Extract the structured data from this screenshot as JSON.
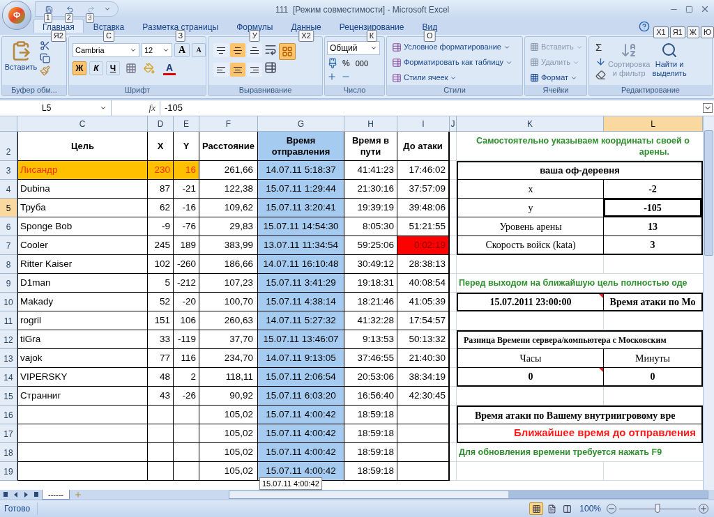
{
  "title_bar": {
    "title": "111  [Режим совместимости] - Microsoft Excel",
    "office_button": "Ф",
    "quick_access": [
      {
        "kind": "save",
        "key_tip": "1",
        "disabled": false
      },
      {
        "kind": "undo",
        "key_tip": "2",
        "disabled": false
      },
      {
        "kind": "redo",
        "key_tip": "3",
        "disabled": true
      }
    ]
  },
  "tabs": [
    {
      "label": "Главная",
      "key_tip": "Я2",
      "selected": true
    },
    {
      "label": "Вставка",
      "key_tip": "С",
      "selected": false
    },
    {
      "label": "Разметка страницы",
      "key_tip": "З",
      "selected": false
    },
    {
      "label": "Формулы",
      "key_tip": "У",
      "selected": false
    },
    {
      "label": "Данные",
      "key_tip": "Х2",
      "selected": false
    },
    {
      "label": "Рецензирование",
      "key_tip": "К",
      "selected": false
    },
    {
      "label": "Вид",
      "key_tip": "О",
      "selected": false
    }
  ],
  "right_key_tips": [
    "X1",
    "Я1",
    "Ж",
    "Ю"
  ],
  "ribbon": {
    "clipboard": {
      "label": "Буфер обм...",
      "paste": "Вставить"
    },
    "font": {
      "label": "Шрифт",
      "family": "Cambria",
      "size": "12",
      "grow": "A",
      "shrink": "A",
      "styles": [
        {
          "kind": "bold",
          "glyph": "Ж",
          "on": true
        },
        {
          "kind": "italic",
          "glyph": "К",
          "on": false
        },
        {
          "kind": "underline",
          "glyph": "Ч",
          "on": false
        }
      ],
      "font_color": "A"
    },
    "alignment": {
      "label": "Выравнивание",
      "vertical": [
        {
          "kind": "top",
          "selected": false
        },
        {
          "kind": "middle",
          "selected": true
        },
        {
          "kind": "bottom",
          "selected": false
        }
      ],
      "horizontal": [
        {
          "kind": "left",
          "selected": false
        },
        {
          "kind": "center",
          "selected": true
        },
        {
          "kind": "right",
          "selected": false
        }
      ],
      "wrap_on": true
    },
    "number": {
      "label": "Число",
      "format": "Общий",
      "percent": "%",
      "thousands": "000"
    },
    "styles": {
      "label": "Стили",
      "items": [
        "Условное форматирование",
        "Форматировать как таблицу",
        "Стили ячеек"
      ]
    },
    "cells": {
      "label": "Ячейки",
      "items": [
        {
          "label": "Вставить",
          "disabled": true
        },
        {
          "label": "Удалить",
          "disabled": true
        },
        {
          "label": "Формат",
          "disabled": false
        }
      ]
    },
    "editing": {
      "label": "Редактирование",
      "sum": "Σ",
      "sort": {
        "lines": [
          "Сортировка",
          "и фильтр"
        ],
        "disabled": true
      },
      "find": {
        "lines": [
          "Найти и",
          "выделить"
        ]
      }
    }
  },
  "formula_bar": {
    "name_box": "L5",
    "fx": "fx",
    "value": "-105"
  },
  "columns": [
    {
      "label": "C",
      "selected": false
    },
    {
      "label": "D",
      "selected": false
    },
    {
      "label": "E",
      "selected": false
    },
    {
      "label": "F",
      "selected": false
    },
    {
      "label": "G",
      "selected": false
    },
    {
      "label": "H",
      "selected": false
    },
    {
      "label": "I",
      "selected": false
    },
    {
      "label": "J",
      "selected": false
    },
    {
      "label": "K",
      "selected": false
    },
    {
      "label": "L",
      "selected": true
    }
  ],
  "header_row": {
    "num": "2",
    "selected": false,
    "cells": [
      "Цель",
      "X",
      "Y",
      "Расстояние",
      "Время отправления",
      "Время в пути",
      "До атаки"
    ],
    "panel": {
      "kind": "note",
      "lines": [
        "Самостоятельно указываем координаты своей о",
        "арены."
      ]
    }
  },
  "rows": [
    {
      "num": "3",
      "selected": false,
      "highlight": true,
      "overdue": false,
      "cells": [
        "Лисандр",
        "230",
        "16",
        "261,66",
        "14.07.11 5:18:37",
        "41:41:23",
        "17:46:02"
      ],
      "panel": {
        "kind": "title",
        "text": "ваша оф-деревня"
      }
    },
    {
      "num": "4",
      "selected": false,
      "highlight": false,
      "overdue": false,
      "cells": [
        "Dubina",
        "87",
        "-21",
        "122,38",
        "15.07.11 1:29:44",
        "21:30:16",
        "37:57:09"
      ],
      "panel": {
        "kind": "pair",
        "left": {
          "text": "x",
          "bold": false,
          "comment": false
        },
        "right": {
          "text": "-2",
          "bold": true,
          "selected": false
        }
      }
    },
    {
      "num": "5",
      "selected": true,
      "highlight": false,
      "overdue": false,
      "cells": [
        "Труба",
        "62",
        "-16",
        "109,62",
        "15.07.11 3:20:41",
        "19:39:19",
        "39:48:06"
      ],
      "panel": {
        "kind": "pair",
        "left": {
          "text": "y",
          "bold": false,
          "comment": false
        },
        "right": {
          "text": "-105",
          "bold": true,
          "selected": true
        }
      }
    },
    {
      "num": "6",
      "selected": false,
      "highlight": false,
      "overdue": false,
      "cells": [
        "Sponge Bob",
        "-9",
        "-76",
        "29,83",
        "15.07.11 14:54:30",
        "8:05:30",
        "51:21:55"
      ],
      "panel": {
        "kind": "pair",
        "left": {
          "text": "Уровень арены",
          "bold": false,
          "comment": false
        },
        "right": {
          "text": "13",
          "bold": true,
          "selected": false
        }
      }
    },
    {
      "num": "7",
      "selected": false,
      "highlight": false,
      "overdue": true,
      "cells": [
        "Cooler",
        "245",
        "189",
        "383,99",
        "13.07.11 11:34:54",
        "59:25:06",
        "0:02:19"
      ],
      "panel": {
        "kind": "pair",
        "left": {
          "text": "Скорость войск (kata)",
          "bold": false,
          "comment": false
        },
        "right": {
          "text": "3",
          "bold": true,
          "selected": false
        }
      }
    },
    {
      "num": "8",
      "selected": false,
      "highlight": false,
      "overdue": false,
      "cells": [
        "Ritter Kaiser",
        "102",
        "-260",
        "186,66",
        "14.07.11 16:10:48",
        "30:49:12",
        "28:38:13"
      ],
      "panel": {
        "kind": "empty"
      }
    },
    {
      "num": "9",
      "selected": false,
      "highlight": false,
      "overdue": false,
      "cells": [
        "D1man",
        "5",
        "-212",
        "107,23",
        "15.07.11 3:41:29",
        "19:18:31",
        "40:08:54"
      ],
      "panel": {
        "kind": "note",
        "lines": [
          "Перед выходом на ближайшую цель полностью оде"
        ]
      }
    },
    {
      "num": "10",
      "selected": false,
      "highlight": false,
      "overdue": false,
      "cells": [
        "Makady",
        "52",
        "-20",
        "100,70",
        "15.07.11 4:38:14",
        "18:21:46",
        "41:05:39"
      ],
      "panel": {
        "kind": "pair",
        "left": {
          "text": "15.07.2011 23:00:00",
          "bold": true,
          "comment": true
        },
        "right": {
          "text": "Время атаки по Мо",
          "bold": true,
          "selected": false
        }
      }
    },
    {
      "num": "11",
      "selected": false,
      "highlight": false,
      "overdue": false,
      "cells": [
        "rogril",
        "151",
        "106",
        "260,63",
        "14.07.11 5:27:32",
        "41:32:28",
        "17:54:57"
      ],
      "panel": {
        "kind": "empty"
      }
    },
    {
      "num": "12",
      "selected": false,
      "highlight": false,
      "overdue": false,
      "cells": [
        "tiGra",
        "33",
        "-119",
        "37,70",
        "15.07.11 13:46:07",
        "9:13:53",
        "50:13:32"
      ],
      "panel": {
        "kind": "caption",
        "text": "Разница Времени сервера/компьютера с Московским"
      }
    },
    {
      "num": "13",
      "selected": false,
      "highlight": false,
      "overdue": false,
      "cells": [
        "vajok",
        "77",
        "116",
        "234,70",
        "14.07.11 9:13:05",
        "37:46:55",
        "21:40:30"
      ],
      "panel": {
        "kind": "pair",
        "left": {
          "text": "Часы",
          "bold": false,
          "comment": false
        },
        "right": {
          "text": "Минуты",
          "bold": false,
          "selected": false
        }
      }
    },
    {
      "num": "14",
      "selected": false,
      "highlight": false,
      "overdue": false,
      "cells": [
        "VIPERSKY",
        "48",
        "2",
        "118,11",
        "15.07.11 2:06:54",
        "20:53:06",
        "38:34:19"
      ],
      "panel": {
        "kind": "pair",
        "left": {
          "text": "0",
          "bold": true,
          "comment": true
        },
        "right": {
          "text": "0",
          "bold": true,
          "selected": false
        }
      }
    },
    {
      "num": "15",
      "selected": false,
      "highlight": false,
      "overdue": false,
      "cells": [
        "Странниг",
        "43",
        "-26",
        "90,92",
        "15.07.11 6:03:20",
        "16:56:40",
        "42:30:45"
      ],
      "panel": {
        "kind": "empty"
      }
    },
    {
      "num": "16",
      "selected": false,
      "highlight": false,
      "overdue": false,
      "cells": [
        "",
        "",
        "",
        "105,02",
        "15.07.11 4:00:42",
        "18:59:18",
        ""
      ],
      "panel": {
        "kind": "caption",
        "text": "Время атаки по Вашему внутриигровому вре"
      }
    },
    {
      "num": "17",
      "selected": false,
      "highlight": false,
      "overdue": false,
      "cells": [
        "",
        "",
        "",
        "105,02",
        "15.07.11 4:00:42",
        "18:59:18",
        ""
      ],
      "panel": {
        "kind": "alert",
        "text": "Ближайшее время до отправления"
      }
    },
    {
      "num": "18",
      "selected": false,
      "highlight": false,
      "overdue": false,
      "cells": [
        "",
        "",
        "",
        "105,02",
        "15.07.11 4:00:42",
        "18:59:18",
        ""
      ],
      "panel": {
        "kind": "note",
        "lines": [
          "Для обновления времени требуется нажать F9"
        ]
      }
    },
    {
      "num": "19",
      "selected": false,
      "highlight": false,
      "overdue": false,
      "cells": [
        "",
        "",
        "",
        "105,02",
        "15.07.11 4:00:42",
        "18:59:18",
        ""
      ],
      "panel": {
        "kind": "empty"
      }
    }
  ],
  "tooltip": "15.07.11 4:00:42",
  "sheet_tabs": [
    {
      "label": "------",
      "selected": true
    }
  ],
  "status_bar": {
    "status": "Готово",
    "views": [
      {
        "kind": "normal",
        "selected": true
      },
      {
        "kind": "layout",
        "selected": false
      },
      {
        "kind": "preview",
        "selected": false
      }
    ],
    "zoom": "100%",
    "zoom_slider": {
      "level": 0.5
    }
  }
}
